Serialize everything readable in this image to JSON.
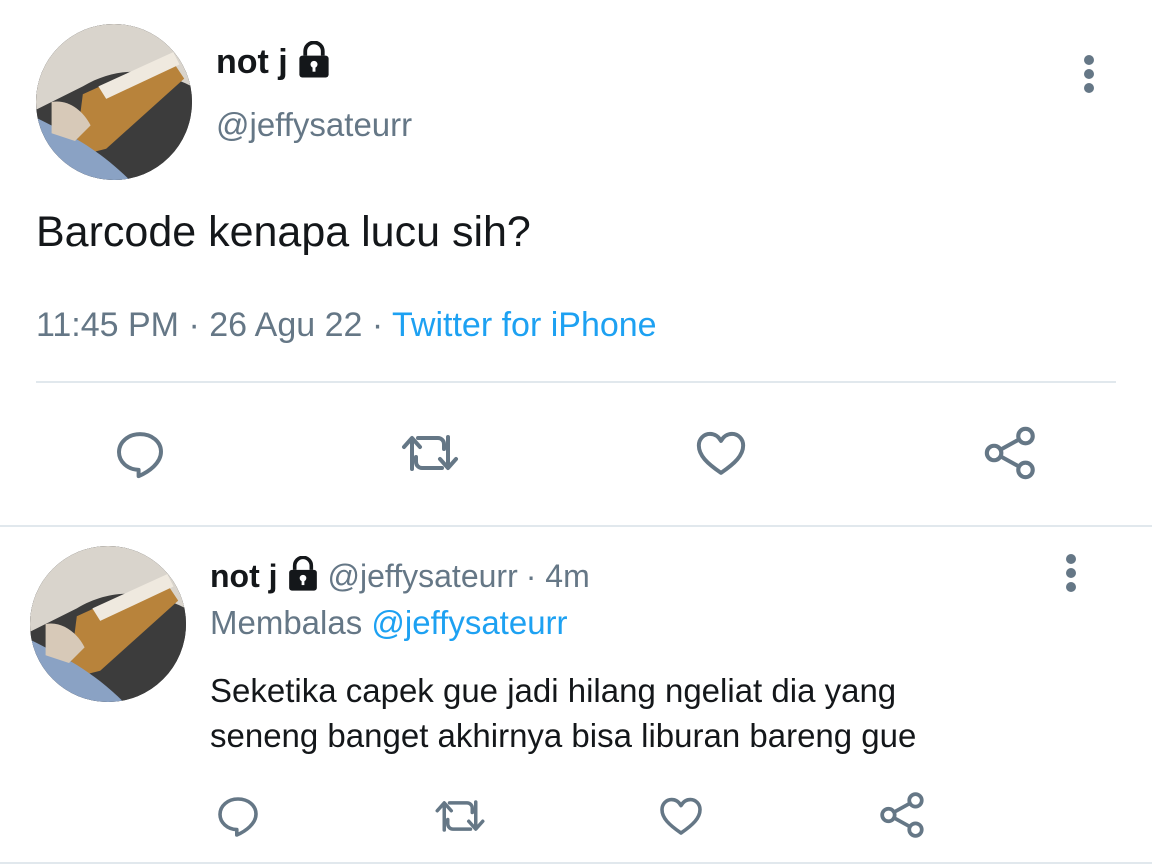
{
  "main_tweet": {
    "display_name": "not j",
    "handle": "@jeffysateurr",
    "text": "Barcode kenapa lucu sih?",
    "time": "11:45 PM",
    "date": "26 Agu 22",
    "separator": "·",
    "source": "Twitter for iPhone",
    "actions": [
      "reply-icon",
      "retweet-icon",
      "like-icon",
      "share-icon"
    ]
  },
  "reply_tweet": {
    "display_name": "not j",
    "handle": "@jeffysateurr",
    "age": "· 4m",
    "replying_label": "Membalas",
    "replying_to": "@jeffysateurr",
    "text_line1": "Seketika capek gue jadi hilang ngeliat dia yang",
    "text_line2": "seneng banget akhirnya bisa liburan bareng gue",
    "actions": [
      "reply-icon",
      "retweet-icon",
      "like-icon",
      "share-icon"
    ]
  },
  "colors": {
    "text": "#14171a",
    "muted": "#657786",
    "link": "#1da1f2",
    "icon": "#657786",
    "divider": "#e1e8ed"
  }
}
